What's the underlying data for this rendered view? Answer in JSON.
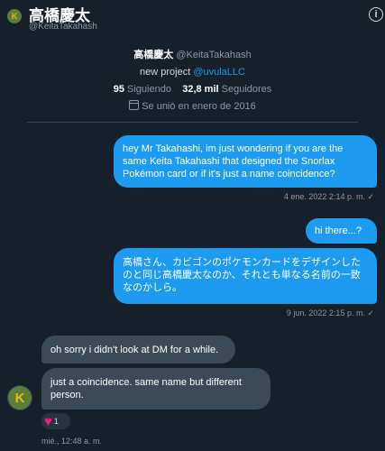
{
  "header": {
    "name": "高橋慶太",
    "handle": "@KeitaTakahash",
    "avatar_letter": "K",
    "info_glyph": "i"
  },
  "profile": {
    "name": "高橋慶太",
    "handle": "@KeitaTakahash",
    "bio_prefix": "new project ",
    "bio_link": "@uvulaLLC",
    "following_count": "95",
    "following_label": "Siguiendo",
    "followers_count": "32,8 mil",
    "followers_label": "Seguidores",
    "joined": "Se unió en enero de 2016"
  },
  "messages": [
    {
      "text": "hey Mr Takahashi, im just wondering if you are the same Keita Takahashi that designed the Snorlax Pokémon card or if it's just a name coincidence?",
      "timestamp": "4 ene. 2022 2:14 p. m. ✓"
    },
    {
      "text": "hi there...?"
    },
    {
      "text": "高橋さん、カビゴンのポケモンカードをデザインしたのと同じ高橋慶太なのか、それとも単なる名前の一致なのかしら。",
      "timestamp": "9 jun. 2022 2:15 p. m. ✓"
    },
    {
      "text": "oh sorry i didn't look at DM for a while."
    },
    {
      "text": "just a coincidence. same name but different person.",
      "timestamp": "mié., 12:48 a. m."
    }
  ],
  "reply_avatar_letter": "K",
  "reaction": {
    "emoji": "♥",
    "count": "1",
    "color": "#f91880"
  },
  "colors": {
    "background": "#15202b",
    "sent_bubble": "#1d9bf0",
    "received_bubble": "#3a4a58",
    "muted_text": "#8b98a5"
  }
}
